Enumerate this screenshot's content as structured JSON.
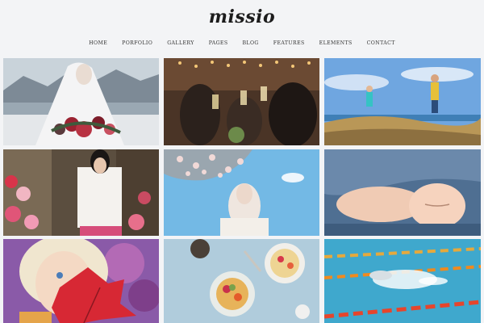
{
  "site": {
    "logo": "missio"
  },
  "nav": {
    "items": [
      "HOME",
      "PORFOLIO",
      "GALLERY",
      "PAGES",
      "BLOG",
      "FEATURES",
      "ELEMENTS",
      "CONTACT"
    ]
  },
  "gallery": {
    "images": [
      {
        "subject": "bride holding bouquet in front of mountain lake"
      },
      {
        "subject": "people toasting with glasses at party"
      },
      {
        "subject": "two children on grassy coastal hill"
      },
      {
        "subject": "woman in white blouse at flower shop"
      },
      {
        "subject": "woman under blossoming branches with blue sky"
      },
      {
        "subject": "sleeping baby on blue blanket"
      },
      {
        "subject": "child holding red autumn leaf"
      },
      {
        "subject": "breakfast bowls on table"
      },
      {
        "subject": "swimmer in pool lane"
      }
    ]
  },
  "colors": {
    "background": "#f3f4f6",
    "text": "#1c1c1c"
  }
}
